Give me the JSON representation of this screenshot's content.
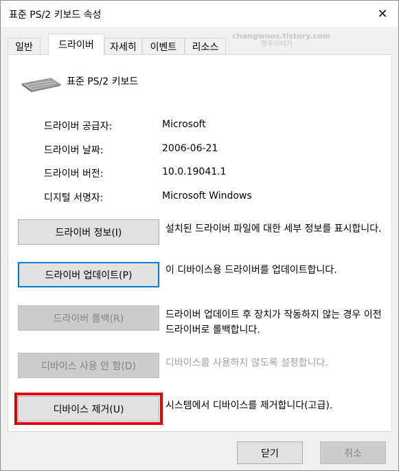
{
  "window": {
    "title": "표준 PS/2 키보드 속성",
    "close_glyph": "✕"
  },
  "tabs": [
    {
      "label": "일반"
    },
    {
      "label": "드라이버"
    },
    {
      "label": "자세히"
    },
    {
      "label": "이벤트"
    },
    {
      "label": "리소스"
    }
  ],
  "watermark": {
    "line1": "changwoos.tistory.com",
    "line2": "짱우이야기"
  },
  "device": {
    "name": "표준 PS/2 키보드",
    "icon": "keyboard-icon"
  },
  "info": [
    {
      "label": "드라이버 공급자:",
      "value": "Microsoft"
    },
    {
      "label": "드라이버 날짜:",
      "value": "2006-06-21"
    },
    {
      "label": "드라이버 버전:",
      "value": "10.0.19041.1"
    },
    {
      "label": "디지털 서명자:",
      "value": "Microsoft Windows"
    }
  ],
  "actions": {
    "details": {
      "label": "드라이버 정보(I)",
      "desc": "설치된 드라이버 파일에 대한 세부 정보를 표시합니다."
    },
    "update": {
      "label": "드라이버 업데이트(P)",
      "desc": "이 디바이스용 드라이버를 업데이트합니다."
    },
    "rollback": {
      "label": "드라이버 롤백(R)",
      "desc": "드라이버 업데이트 후 장치가 작동하지 않는 경우 이전 드라이버로 롤백합니다."
    },
    "disable": {
      "label": "디바이스 사용 안 함(D)",
      "desc": "디바이스를 사용하지 않도록 설정합니다."
    },
    "uninstall": {
      "label": "디바이스 제거(U)",
      "desc": "시스템에서 디바이스를 제거합니다(고급)."
    }
  },
  "footer": {
    "close_label": "닫기",
    "cancel_label": "취소"
  },
  "colors": {
    "highlight_border": "#e00000",
    "focus_border": "#0078d7"
  }
}
